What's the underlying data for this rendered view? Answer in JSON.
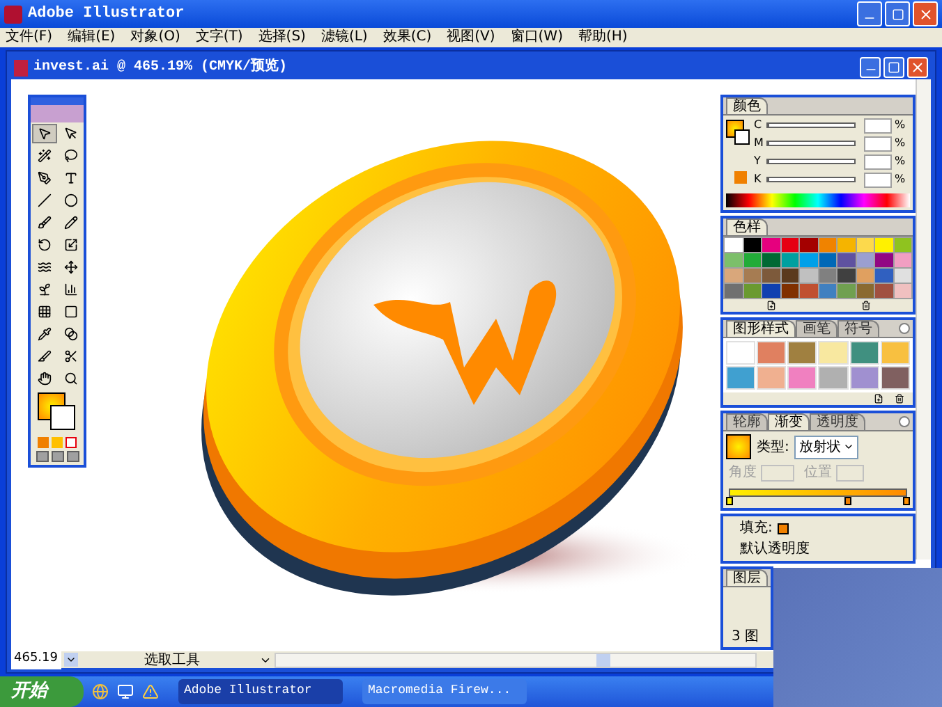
{
  "window": {
    "title": "Adobe Illustrator"
  },
  "menu": [
    "文件(F)",
    "编辑(E)",
    "对象(O)",
    "文字(T)",
    "选择(S)",
    "滤镜(L)",
    "效果(C)",
    "视图(V)",
    "窗口(W)",
    "帮助(H)"
  ],
  "document": {
    "title": "invest.ai @ 465.19% (CMYK/预览)"
  },
  "tools": [
    {
      "kind": "select",
      "selected": true
    },
    {
      "kind": "direct",
      "selected": false
    },
    {
      "kind": "wand",
      "selected": false
    },
    {
      "kind": "lasso",
      "selected": false
    },
    {
      "kind": "pen",
      "selected": false
    },
    {
      "kind": "type",
      "selected": false
    },
    {
      "kind": "line",
      "selected": false
    },
    {
      "kind": "ellipse",
      "selected": false
    },
    {
      "kind": "brush",
      "selected": false
    },
    {
      "kind": "pencil",
      "selected": false
    },
    {
      "kind": "rotate",
      "selected": false
    },
    {
      "kind": "scale",
      "selected": false
    },
    {
      "kind": "warp",
      "selected": false
    },
    {
      "kind": "transform",
      "selected": false
    },
    {
      "kind": "symbol",
      "selected": false
    },
    {
      "kind": "graph",
      "selected": false
    },
    {
      "kind": "mesh",
      "selected": false
    },
    {
      "kind": "gradient",
      "selected": false
    },
    {
      "kind": "eyedropper",
      "selected": false
    },
    {
      "kind": "blend",
      "selected": false
    },
    {
      "kind": "slice",
      "selected": false
    },
    {
      "kind": "scissors",
      "selected": false
    },
    {
      "kind": "hand",
      "selected": false
    },
    {
      "kind": "zoom",
      "selected": false
    }
  ],
  "color_panel": {
    "tab": "颜色",
    "channels": [
      {
        "name": "C",
        "unit": "%",
        "level": 0
      },
      {
        "name": "M",
        "unit": "%",
        "level": 0
      },
      {
        "name": "Y",
        "unit": "%",
        "level": 0
      },
      {
        "name": "K",
        "unit": "%",
        "level": 0
      }
    ]
  },
  "swatches_panel": {
    "tab": "色样",
    "swatches": [
      {
        "color": "#ffffff"
      },
      {
        "color": "#000000"
      },
      {
        "color": "#e6007e"
      },
      {
        "color": "#e60012"
      },
      {
        "color": "#a40000"
      },
      {
        "color": "#f08300"
      },
      {
        "color": "#f5b400"
      },
      {
        "color": "#fcd94c"
      },
      {
        "color": "#fff100"
      },
      {
        "color": "#8fc31f"
      },
      {
        "color": "#7cbf6a"
      },
      {
        "color": "#22ac38"
      },
      {
        "color": "#006934"
      },
      {
        "color": "#00a0a0"
      },
      {
        "color": "#00a0e9"
      },
      {
        "color": "#0068b7"
      },
      {
        "color": "#5f52a0"
      },
      {
        "color": "#9b9fd0"
      },
      {
        "color": "#920783"
      },
      {
        "color": "#f19ec2"
      },
      {
        "color": "#d9a77b"
      },
      {
        "color": "#a67c52"
      },
      {
        "color": "#7d5a3b"
      },
      {
        "color": "#5b3a1d"
      },
      {
        "color": "#c0c0c0"
      },
      {
        "color": "#808080"
      },
      {
        "color": "#404040"
      },
      {
        "color": "#e0a060"
      },
      {
        "color": "#3060c0"
      },
      {
        "color": "#e0e0e0"
      },
      {
        "color": "#707070"
      },
      {
        "color": "#6a9a30"
      },
      {
        "color": "#1040b0"
      },
      {
        "color": "#803000"
      },
      {
        "color": "#c05030"
      },
      {
        "color": "#4080c0"
      },
      {
        "color": "#70a050"
      },
      {
        "color": "#8a6a30"
      },
      {
        "color": "#a05040"
      },
      {
        "color": "#f0c0c0"
      }
    ]
  },
  "styles_panel": {
    "tabs": [
      {
        "label": "图形样式",
        "selected": true
      },
      {
        "label": "画笔",
        "selected": false
      },
      {
        "label": "符号",
        "selected": false
      }
    ],
    "styles": [
      {
        "color": "#ffffff"
      },
      {
        "color": "#e08060"
      },
      {
        "color": "#a08040"
      },
      {
        "color": "#f8e8a0"
      },
      {
        "color": "#409080"
      },
      {
        "color": "#f8c040"
      },
      {
        "color": "#40a0d0"
      },
      {
        "color": "#f0b090"
      },
      {
        "color": "#f080c0"
      },
      {
        "color": "#b0b0b0"
      },
      {
        "color": "#a090d0"
      },
      {
        "color": "#806060"
      }
    ]
  },
  "gradient_panel": {
    "tabs": [
      {
        "label": "轮廓",
        "selected": false
      },
      {
        "label": "渐变",
        "selected": true
      },
      {
        "label": "透明度",
        "selected": false
      }
    ],
    "type_label": "类型:",
    "type_value": "放射状",
    "angle_label": "角度",
    "position_label": "位置"
  },
  "transparency_panel": {
    "fill_label": "填充:",
    "opacity_label": "默认透明度"
  },
  "layers_panel": {
    "tab": "图层",
    "footer": "3 图"
  },
  "status_bar": {
    "zoom": "465.19",
    "tool": "选取工具"
  },
  "taskbar": {
    "start": "开始",
    "tasks": [
      {
        "label": "Adobe Illustrator",
        "selected": true
      },
      {
        "label": "Macromedia Firew...",
        "selected": false
      }
    ]
  }
}
